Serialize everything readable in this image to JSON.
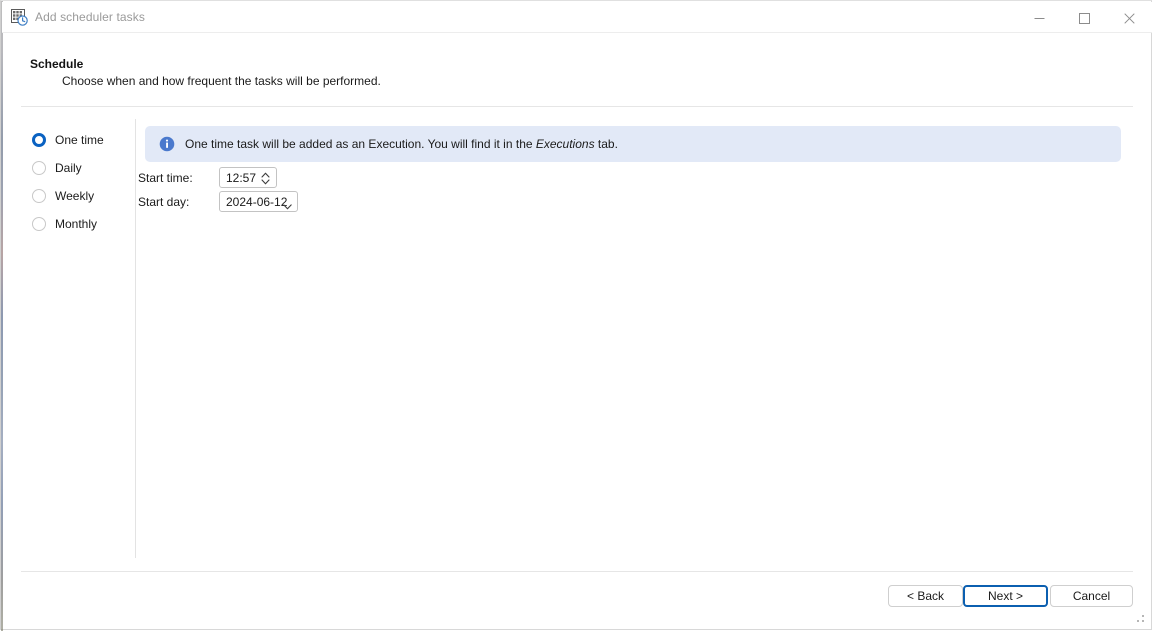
{
  "window": {
    "title": "Add scheduler tasks",
    "icon": "scheduler-calendar-clock-icon",
    "controls": {
      "minimize": "minimize-icon",
      "maximize": "maximize-icon",
      "close": "close-icon"
    }
  },
  "header": {
    "title": "Schedule",
    "subtitle": "Choose when and how frequent the tasks will be performed."
  },
  "frequency": {
    "options": [
      {
        "label": "One time",
        "selected": true
      },
      {
        "label": "Daily",
        "selected": false
      },
      {
        "label": "Weekly",
        "selected": false
      },
      {
        "label": "Monthly",
        "selected": false
      }
    ]
  },
  "banner": {
    "icon": "info-icon",
    "text_before": "One time task will be added as an Execution. You will find it in the ",
    "text_emphasis": "Executions",
    "text_after": " tab.",
    "background_color": "#e2e9f7",
    "icon_color": "#4a79cd"
  },
  "form": {
    "start_time": {
      "label": "Start time:",
      "value": "12:57",
      "spinner_icon": "spinner-up-down-icon"
    },
    "start_day": {
      "label": "Start day:",
      "value": "2024-06-12",
      "caret_icon": "chevron-down-icon"
    }
  },
  "footer": {
    "back_label": "< Back",
    "next_label": "Next >",
    "cancel_label": "Cancel",
    "next_focus_color": "#0b5fb0"
  }
}
